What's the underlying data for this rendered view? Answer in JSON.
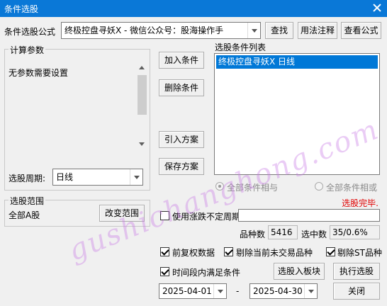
{
  "window": {
    "title": "条件选股"
  },
  "formula": {
    "label": "条件选股公式",
    "value": "终极控盘寻妖X  -  微信公众号：股海操作手",
    "find_button": "查找",
    "usage_button": "用法注释",
    "view_button": "查看公式"
  },
  "params": {
    "group_label": "计算参数",
    "empty_text": "无参数需要设置"
  },
  "period": {
    "label": "选股周期:",
    "value": "日线"
  },
  "actions": {
    "add_condition": "加入条件",
    "delete_condition": "删除条件",
    "import_plan": "引入方案",
    "save_plan": "保存方案"
  },
  "conditions": {
    "label": "选股条件列表",
    "items": [
      "终极控盘寻妖X  日线"
    ],
    "radio_and": "全部条件相与",
    "radio_or": "全部条件相或"
  },
  "status": {
    "text": "选股完毕.",
    "color": "#e00000"
  },
  "scope": {
    "group_label": "选股范围",
    "value": "全部A股",
    "change_button": "改变范围"
  },
  "options": {
    "variable_period": "使用涨跌不定周期",
    "forward_adjust": "前复权数据",
    "exclude_no_trade": "剔除当前未交易品种",
    "exclude_st": "剔除ST品种",
    "time_range": "时间段内满足条件"
  },
  "stats": {
    "count_label": "品种数",
    "count_value": "5416",
    "selected_label": "选中数",
    "selected_value": "35/0.6%"
  },
  "buttons": {
    "to_block": "选股入板块",
    "execute": "执行选股",
    "close": "关闭"
  },
  "dates": {
    "start": "2025-04-01",
    "separator": "-",
    "end": "2025-04-30"
  },
  "watermark": "gushichanghong.com",
  "colors": {
    "titlebar": "#0a78d7",
    "selection": "#0078d7"
  }
}
